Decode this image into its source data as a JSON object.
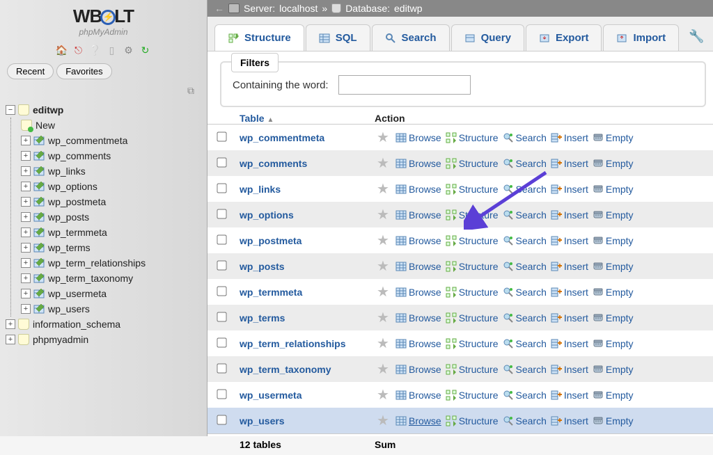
{
  "logo": {
    "main": "WB",
    "tail": "LT",
    "sub": "phpMyAdmin"
  },
  "sidebar_tabs": {
    "recent": "Recent",
    "favorites": "Favorites"
  },
  "tree": {
    "db": "editwp",
    "new": "New",
    "tables": [
      "wp_commentmeta",
      "wp_comments",
      "wp_links",
      "wp_options",
      "wp_postmeta",
      "wp_posts",
      "wp_termmeta",
      "wp_terms",
      "wp_term_relationships",
      "wp_term_taxonomy",
      "wp_usermeta",
      "wp_users"
    ],
    "other_dbs": [
      "information_schema",
      "phpmyadmin"
    ]
  },
  "breadcrumb": {
    "server_label": "Server:",
    "server": "localhost",
    "sep": "»",
    "db_label": "Database:",
    "db": "editwp"
  },
  "tabs": [
    "Structure",
    "SQL",
    "Search",
    "Query",
    "Export",
    "Import"
  ],
  "filters": {
    "legend": "Filters",
    "label": "Containing the word:",
    "value": ""
  },
  "columns": {
    "table": "Table",
    "action": "Action"
  },
  "row_actions": {
    "browse": "Browse",
    "structure": "Structure",
    "search": "Search",
    "insert": "Insert",
    "empty": "Empty"
  },
  "rows": [
    "wp_commentmeta",
    "wp_comments",
    "wp_links",
    "wp_options",
    "wp_postmeta",
    "wp_posts",
    "wp_termmeta",
    "wp_terms",
    "wp_term_relationships",
    "wp_term_taxonomy",
    "wp_usermeta",
    "wp_users"
  ],
  "footer": {
    "count": "12 tables",
    "sum": "Sum"
  }
}
